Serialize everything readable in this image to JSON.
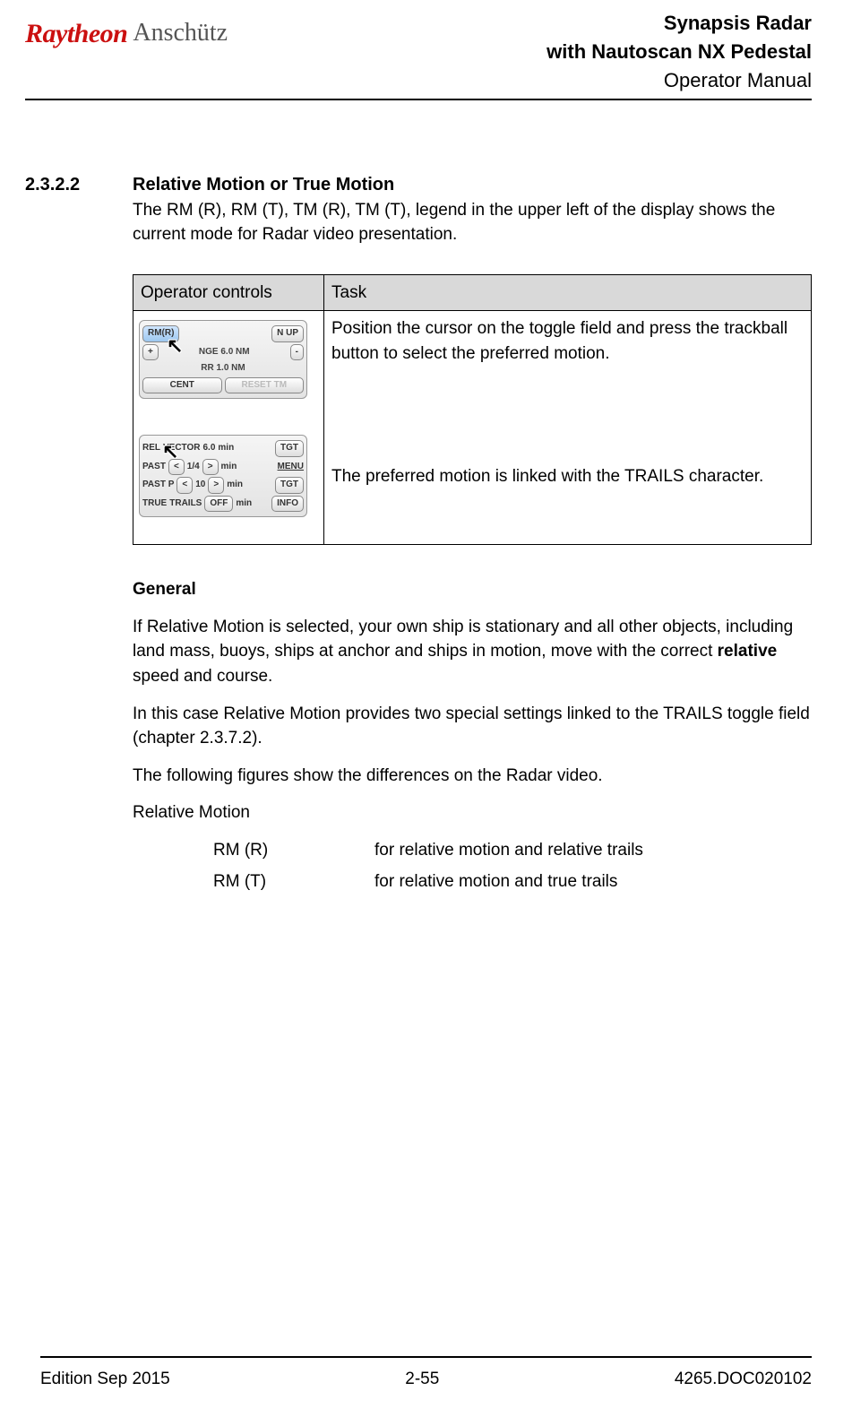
{
  "header": {
    "logo_brand1": "Raytheon",
    "logo_brand2": "Anschütz",
    "title1": "Synapsis Radar",
    "title2": "with Nautoscan NX Pedestal",
    "title3": "Operator Manual"
  },
  "section": {
    "number": "2.3.2.2",
    "title": "Relative Motion or True Motion",
    "intro": "The RM (R), RM (T), TM (R), TM (T), legend in the upper left of the display shows the current mode for Radar video presentation."
  },
  "table": {
    "th1": "Operator controls",
    "th2": "Task",
    "task1": "Position the cursor on the toggle field and press the trackball button to select the preferred motion.",
    "task2": "The preferred motion is linked with the TRAILS character."
  },
  "panel1": {
    "rm": "RM(R)",
    "nup": "N UP",
    "plus": "+",
    "range": "NGE 6.0 NM",
    "minus": "-",
    "rr": "RR 1.0 NM",
    "cent": "CENT",
    "reset": "RESET TM"
  },
  "panel2": {
    "l1a": "REL",
    "l1b": "VECTOR",
    "l1c": "6.0",
    "l1d": "min",
    "l1e": "TGT",
    "l2a": "PAST",
    "l2b": "<",
    "l2c": "1/4",
    "l2d": ">",
    "l2e": "min",
    "l2f": "MENU",
    "l3a": "PAST P",
    "l3c": "10",
    "l3e": "min",
    "l3f": "TGT",
    "l4a": "TRUE",
    "l4b": "TRAILS",
    "l4c": "OFF",
    "l4d": "min",
    "l4e": "INFO"
  },
  "general": {
    "heading": "General",
    "p1a": "If Relative Motion is selected, your own ship is stationary and all other objects, including land mass, buoys, ships at anchor and ships in motion, move with the correct ",
    "p1b_bold": "relative",
    "p1c": " speed and course.",
    "p2": "In this case Relative Motion provides two special settings linked to the TRAILS toggle field (chapter 2.3.7.2).",
    "p3": "The following figures show the differences on the Radar video.",
    "p4": "Relative Motion",
    "def1_term": "RM (R)",
    "def1_desc": "for relative motion and relative trails",
    "def2_term": "RM (T)",
    "def2_desc": "for relative motion and true trails"
  },
  "footer": {
    "left": "Edition Sep 2015",
    "center": "2-55",
    "right": "4265.DOC020102"
  }
}
